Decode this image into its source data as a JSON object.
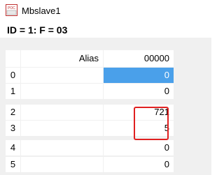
{
  "window": {
    "title": "Mbslave1",
    "app_icon": "modbus-slave-app-icon"
  },
  "status_line": "ID = 1: F = 03",
  "grid": {
    "columns": [
      "Alias",
      "00000"
    ],
    "rows": [
      {
        "index": "0",
        "alias": "",
        "value": "0",
        "selected": true
      },
      {
        "index": "1",
        "alias": "",
        "value": "0",
        "selected": false
      },
      {
        "index": "2",
        "alias": "",
        "value": "721",
        "selected": false
      },
      {
        "index": "3",
        "alias": "",
        "value": "5",
        "selected": false
      },
      {
        "index": "4",
        "alias": "",
        "value": "0",
        "selected": false
      },
      {
        "index": "5",
        "alias": "",
        "value": "0",
        "selected": false
      }
    ]
  },
  "colors": {
    "selection": "#4aa0ea",
    "annotation": "#e02020",
    "grid_line": "#c8c8c8"
  }
}
